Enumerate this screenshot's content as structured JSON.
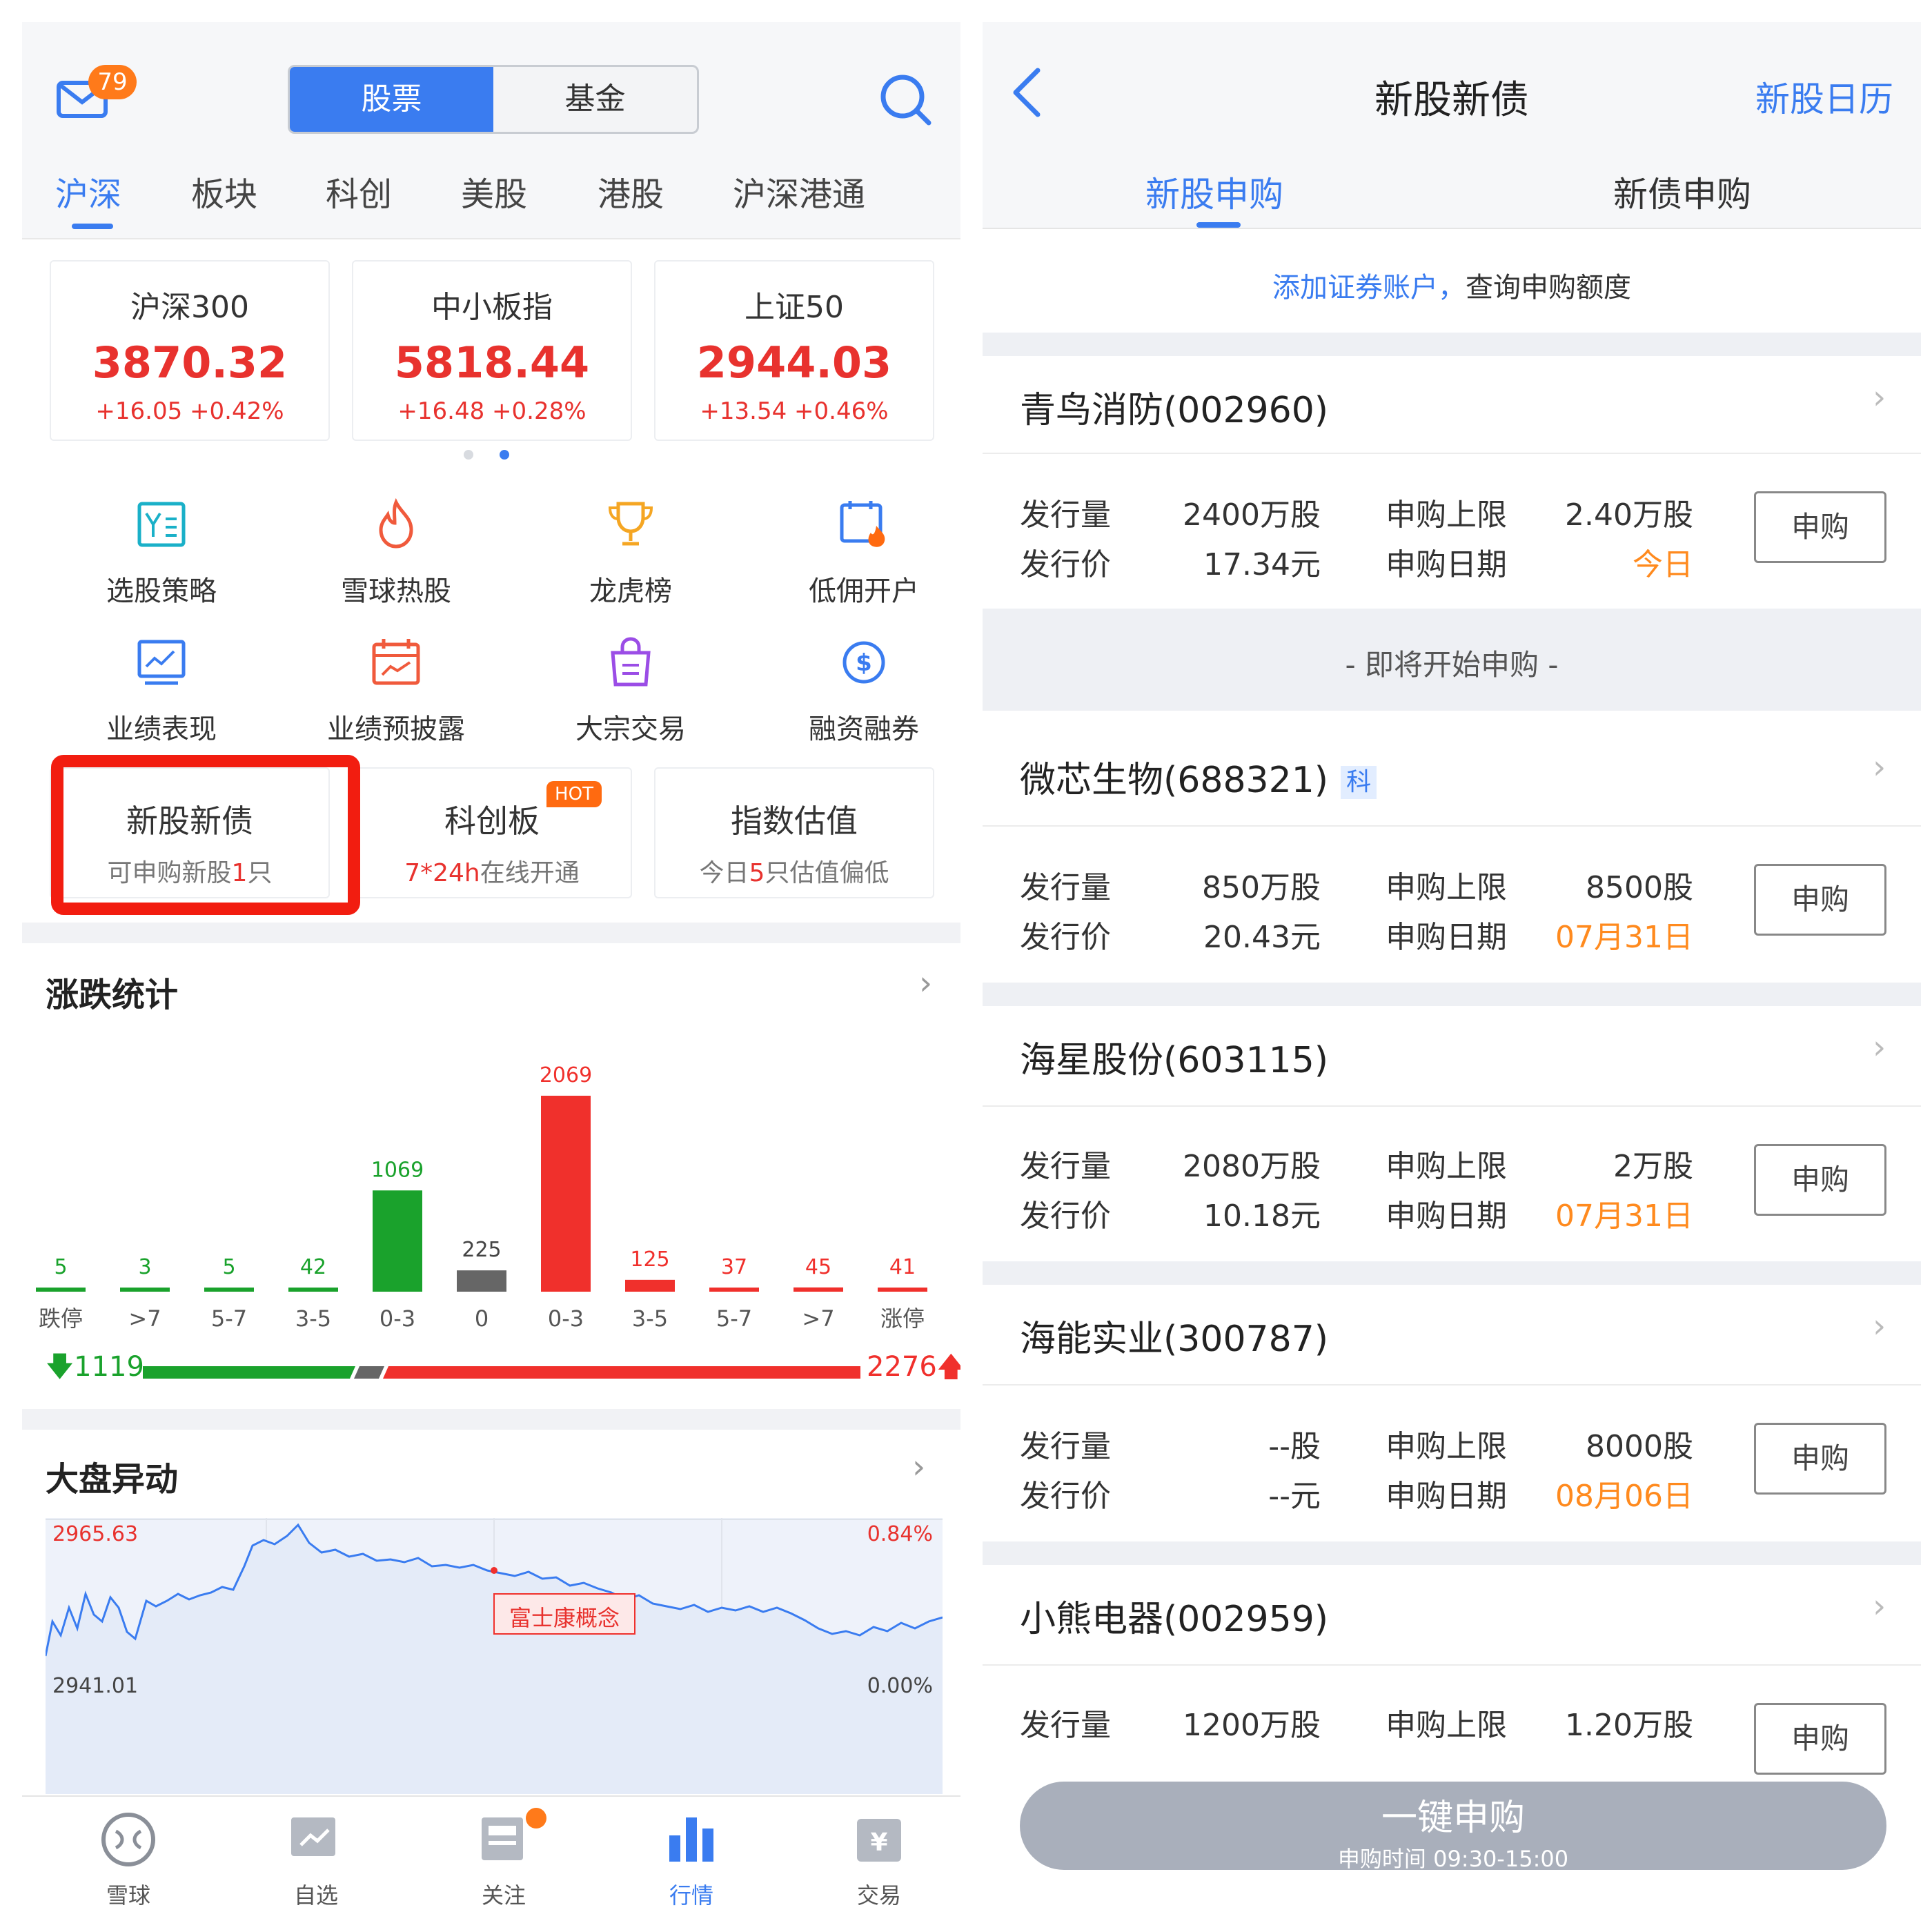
{
  "left": {
    "mail_badge": "79",
    "segment": {
      "stock": "股票",
      "fund": "基金"
    },
    "tabs": [
      "沪深",
      "板块",
      "科创",
      "美股",
      "港股",
      "沪深港通"
    ],
    "indices": [
      {
        "name": "沪深300",
        "value": "3870.32",
        "change": "+16.05 +0.42%"
      },
      {
        "name": "中小板指",
        "value": "5818.44",
        "change": "+16.48 +0.28%"
      },
      {
        "name": "上证50",
        "value": "2944.03",
        "change": "+13.54 +0.46%"
      }
    ],
    "grid": [
      "选股策略",
      "雪球热股",
      "龙虎榜",
      "低佣开户",
      "业绩表现",
      "业绩预披露",
      "大宗交易",
      "融资融券"
    ],
    "cards": [
      {
        "title": "新股新债",
        "sub_pre": "可申购新股",
        "sub_num": "1",
        "sub_post": "只"
      },
      {
        "title": "科创板",
        "badge": "HOT",
        "sub_num": "7*24h",
        "sub_post": "在线开通"
      },
      {
        "title": "指数估值",
        "sub_pre": "今日",
        "sub_num": "5",
        "sub_post": "只估值偏低"
      }
    ],
    "stats_title": "涨跌统计",
    "market_title": "大盘异动",
    "down_total": "1119",
    "up_total": "2276",
    "market_chart": {
      "top_left": "2965.63",
      "top_right": "0.84%",
      "bottom_left": "2941.01",
      "bottom_right": "0.00%",
      "annotation": "富士康概念"
    },
    "nav": [
      "雪球",
      "自选",
      "关注",
      "行情",
      "交易"
    ]
  },
  "chart_data": {
    "type": "bar",
    "categories": [
      "跌停",
      ">7",
      "5-7",
      "3-5",
      "0-3",
      "0",
      "0-3",
      "3-5",
      "5-7",
      ">7",
      "涨停"
    ],
    "values": [
      5,
      3,
      5,
      42,
      1069,
      225,
      2069,
      125,
      37,
      45,
      41
    ],
    "colors": [
      "#1aa22c",
      "#1aa22c",
      "#1aa22c",
      "#1aa22c",
      "#1aa22c",
      "#666666",
      "#f0302c",
      "#f0302c",
      "#f0302c",
      "#f0302c",
      "#f0302c"
    ]
  },
  "right": {
    "title": "新股新债",
    "calendar": "新股日历",
    "tabs": [
      "新股申购",
      "新债申购"
    ],
    "add_account_link": "添加证券账户，",
    "add_account_text": "查询申购额度",
    "labels": {
      "issue_vol": "发行量",
      "issue_price": "发行价",
      "limit": "申购上限",
      "date": "申购日期",
      "apply": "申购"
    },
    "soon": "- 即将开始申购 -",
    "stocks": [
      {
        "name": "青鸟消防(002960)",
        "vol": "2400万股",
        "price": "17.34元",
        "limit": "2.40万股",
        "date": "今日"
      },
      {
        "name": "微芯生物(688321)",
        "tag": "科",
        "vol": "850万股",
        "price": "20.43元",
        "limit": "8500股",
        "date": "07月31日"
      },
      {
        "name": "海星股份(603115)",
        "vol": "2080万股",
        "price": "10.18元",
        "limit": "2万股",
        "date": "07月31日"
      },
      {
        "name": "海能实业(300787)",
        "vol": "--股",
        "price": "--元",
        "limit": "8000股",
        "date": "08月06日"
      },
      {
        "name": "小熊电器(002959)",
        "vol": "1200万股",
        "limit": "1.20万股"
      }
    ],
    "onekey": {
      "label": "一键申购",
      "time": "申购时间 09:30-15:00"
    }
  }
}
